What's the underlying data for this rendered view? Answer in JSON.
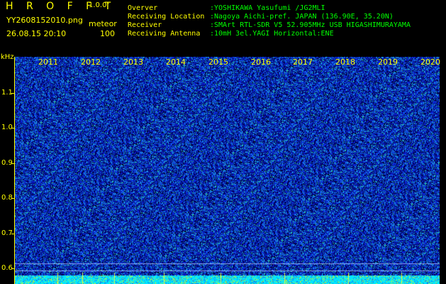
{
  "header": {
    "title": "H R O F F T",
    "version": "1.0.0f",
    "filename": "YY2608152010.png",
    "datetime": "26.08.15 20:10",
    "mode": "meteor",
    "count": "100"
  },
  "info": [
    {
      "label": "Overver",
      "value": ":YOSHIKAWA Yasufumi /JG2MLI"
    },
    {
      "label": "Receiving Location",
      "value": ":Nagoya Aichi-pref. JAPAN (136.90E, 35.20N)"
    },
    {
      "label": "Receiver",
      "value": ":SMArt RTL-SDR V5 52.905MHz USB HIGASHIMURAYAMA"
    },
    {
      "label": "Receiving Antenna",
      "value": ":10mH 3el.YAGI Horizontal:ENE"
    }
  ],
  "axis": {
    "unit": "kHz",
    "y_ticks": [
      "1.1",
      "1.0",
      "0.9",
      "0.8",
      "0.7",
      "0.6"
    ],
    "x_ticks": [
      "2011",
      "2012",
      "2013",
      "2014",
      "2015",
      "2016",
      "2017",
      "2018",
      "2019",
      "2020"
    ]
  },
  "colors": {
    "label": "#ffff00",
    "value": "#00ff00",
    "background": "#000000",
    "noise_base": "#1010c0"
  }
}
